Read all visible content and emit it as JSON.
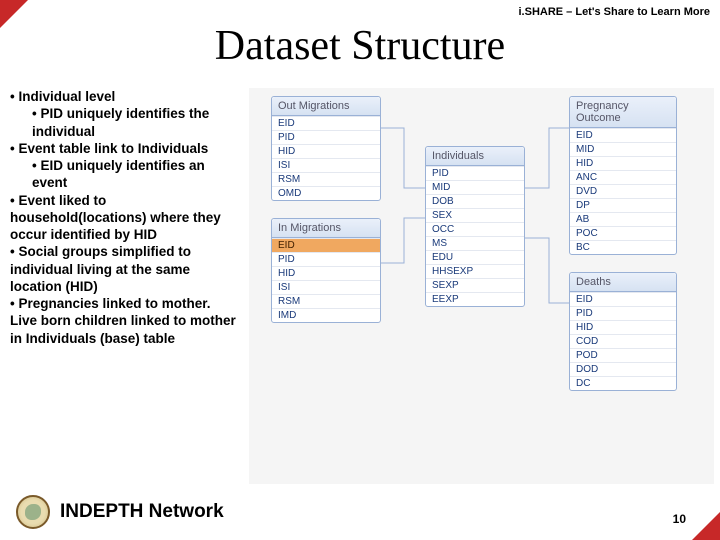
{
  "tagline": "i.SHARE – Let's Share to Learn More",
  "title": "Dataset Structure",
  "bullets": [
    {
      "level": 1,
      "text": "• Individual level"
    },
    {
      "level": 2,
      "text": "• PID uniquely identifies the individual"
    },
    {
      "level": 1,
      "text": "• Event table link to Individuals"
    },
    {
      "level": 2,
      "text": "• EID uniquely identifies an event"
    },
    {
      "level": 1,
      "text": "• Event liked to household(locations) where they occur identified by HID"
    },
    {
      "level": 1,
      "text": "• Social groups simplified to individual living at the same location (HID)"
    },
    {
      "level": 1,
      "text": "• Pregnancies linked to mother. Live born children linked to mother in Individuals (base) table"
    }
  ],
  "tables": {
    "out": {
      "name": "Out Migrations",
      "fields": [
        "EID",
        "PID",
        "HID",
        "ISI",
        "RSM",
        "OMD"
      ]
    },
    "in": {
      "name": "In Migrations",
      "fields": [
        "EID",
        "PID",
        "HID",
        "ISI",
        "RSM",
        "IMD"
      ],
      "highlight": 0
    },
    "ind": {
      "name": "Individuals",
      "fields": [
        "PID",
        "MID",
        "DOB",
        "SEX",
        "OCC",
        "MS",
        "EDU",
        "HHSEXP",
        "SEXP",
        "EEXP"
      ]
    },
    "preg": {
      "name": "Pregnancy Outcome",
      "fields": [
        "EID",
        "MID",
        "HID",
        "ANC",
        "DVD",
        "DP",
        "AB",
        "POC",
        "BC"
      ]
    },
    "death": {
      "name": "Deaths",
      "fields": [
        "EID",
        "PID",
        "HID",
        "COD",
        "POD",
        "DOD",
        "DC"
      ]
    }
  },
  "footer": {
    "org": "INDEPTH Network",
    "page": "10"
  }
}
